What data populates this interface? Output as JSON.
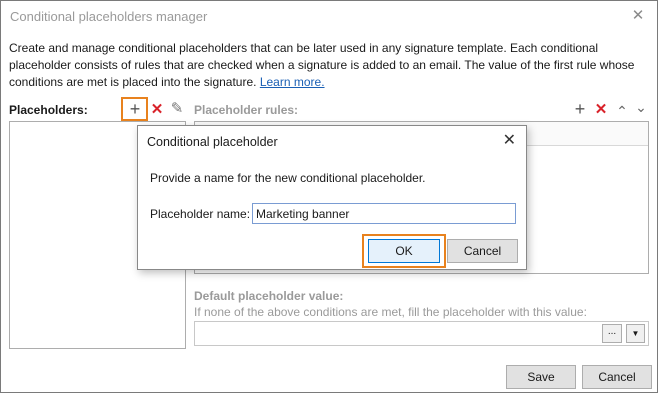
{
  "window": {
    "title": "Conditional placeholders manager",
    "close_glyph": "✕"
  },
  "description": {
    "text": "Create and manage conditional placeholders that can be later used in any signature template. Each conditional placeholder consists of rules that are checked when a signature is added to an email. The value of the first rule whose conditions are met is placed into the signature.",
    "link": "Learn more."
  },
  "placeholders": {
    "label": "Placeholders:",
    "add_glyph": "+",
    "delete_glyph": "✕",
    "edit_glyph": "✎"
  },
  "rules": {
    "label": "Placeholder rules:",
    "add_glyph": "+",
    "delete_glyph": "✕",
    "up_glyph": "⌃",
    "down_glyph": "⌄"
  },
  "default_value": {
    "label": "Default placeholder value:",
    "hint": "If none of the above conditions are met, fill the placeholder with this value:",
    "dots_glyph": "...",
    "arrow_glyph": "▼"
  },
  "footer": {
    "save": "Save",
    "cancel": "Cancel"
  },
  "dialog": {
    "title": "Conditional placeholder",
    "close_glyph": "✕",
    "prompt": "Provide a name for the new conditional placeholder.",
    "name_label": "Placeholder name:",
    "name_value": "Marketing banner",
    "ok": "OK",
    "cancel": "Cancel"
  },
  "colors": {
    "highlight": "#e8821e",
    "delete_red": "#d9222a",
    "link": "#1a5fb4"
  },
  "icons": [
    "close-icon",
    "plus-icon",
    "delete-icon",
    "edit-icon",
    "move-up-icon",
    "move-down-icon",
    "dropdown-arrow-icon"
  ]
}
